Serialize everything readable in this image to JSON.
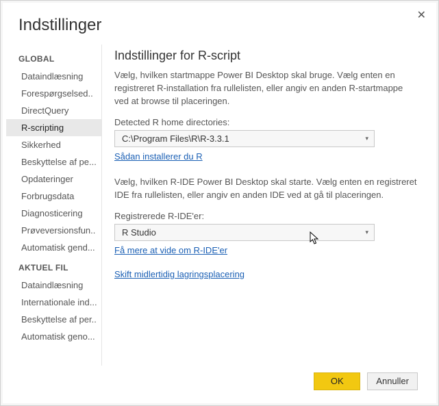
{
  "dialog": {
    "title": "Indstillinger",
    "close_label": "✕"
  },
  "sidebar": {
    "global_header": "GLOBAL",
    "aktuel_header": "AKTUEL FIL",
    "global_items": [
      "Dataindlæsning",
      "Forespørgselsed..",
      "DirectQuery",
      "R-scripting",
      "Sikkerhed",
      "Beskyttelse af pe...",
      "Opdateringer",
      "Forbrugsdata",
      "Diagnosticering",
      "Prøveversionsfun..",
      "Automatisk gend..."
    ],
    "aktuel_items": [
      "Dataindlæsning",
      "Internationale ind...",
      "Beskyttelse af per..",
      "Automatisk geno..."
    ],
    "selected_index": 3
  },
  "content": {
    "heading": "Indstillinger for R-script",
    "desc1": "Vælg, hvilken startmappe Power BI Desktop skal bruge. Vælg enten en registreret R-installation fra rullelisten, eller angiv en anden R-startmappe ved at browse til placeringen.",
    "r_home_label": "Detected R home directories:",
    "r_home_value": "C:\\Program Files\\R\\R-3.3.1",
    "r_install_link": "Sådan installerer du R",
    "desc2": "Vælg, hvilken R-IDE Power BI Desktop skal starte. Vælg enten en registreret IDE fra rullelisten, eller angiv en anden IDE ved at gå til placeringen.",
    "r_ide_label": "Registrerede R-IDE'er:",
    "r_ide_value": "R Studio",
    "r_ide_link": "Få mere at vide om R-IDE'er",
    "temp_storage_link": "Skift midlertidig lagringsplacering"
  },
  "footer": {
    "ok": "OK",
    "cancel": "Annuller"
  }
}
